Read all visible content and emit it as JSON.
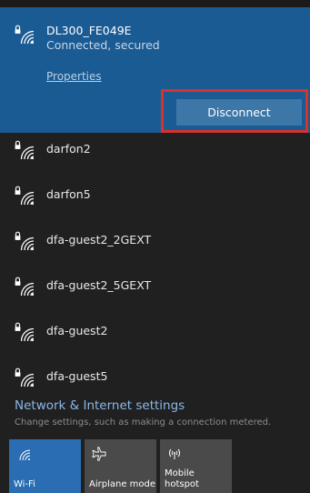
{
  "connected_network": {
    "ssid": "DL300_FE049E",
    "status": "Connected, secured",
    "properties_link": "Properties",
    "disconnect_label": "Disconnect"
  },
  "networks": [
    {
      "name": "darfon2"
    },
    {
      "name": "darfon5"
    },
    {
      "name": "dfa-guest2_2GEXT"
    },
    {
      "name": "dfa-guest2_5GEXT"
    },
    {
      "name": "dfa-guest2"
    },
    {
      "name": "dfa-guest5"
    }
  ],
  "settings": {
    "title": "Network & Internet settings",
    "description": "Change settings, such as making a connection metered."
  },
  "quick_actions": [
    {
      "label": "Wi-Fi",
      "icon": "wifi-icon",
      "active": true
    },
    {
      "label": "Airplane mode",
      "icon": "airplane-icon",
      "active": false
    },
    {
      "label": "Mobile\nhotspot",
      "icon": "hotspot-icon",
      "active": false
    }
  ],
  "colors": {
    "accent": "#1a5b93",
    "highlight_box": "#d9322b",
    "background": "#202020",
    "active_tile": "#2a6db2"
  }
}
